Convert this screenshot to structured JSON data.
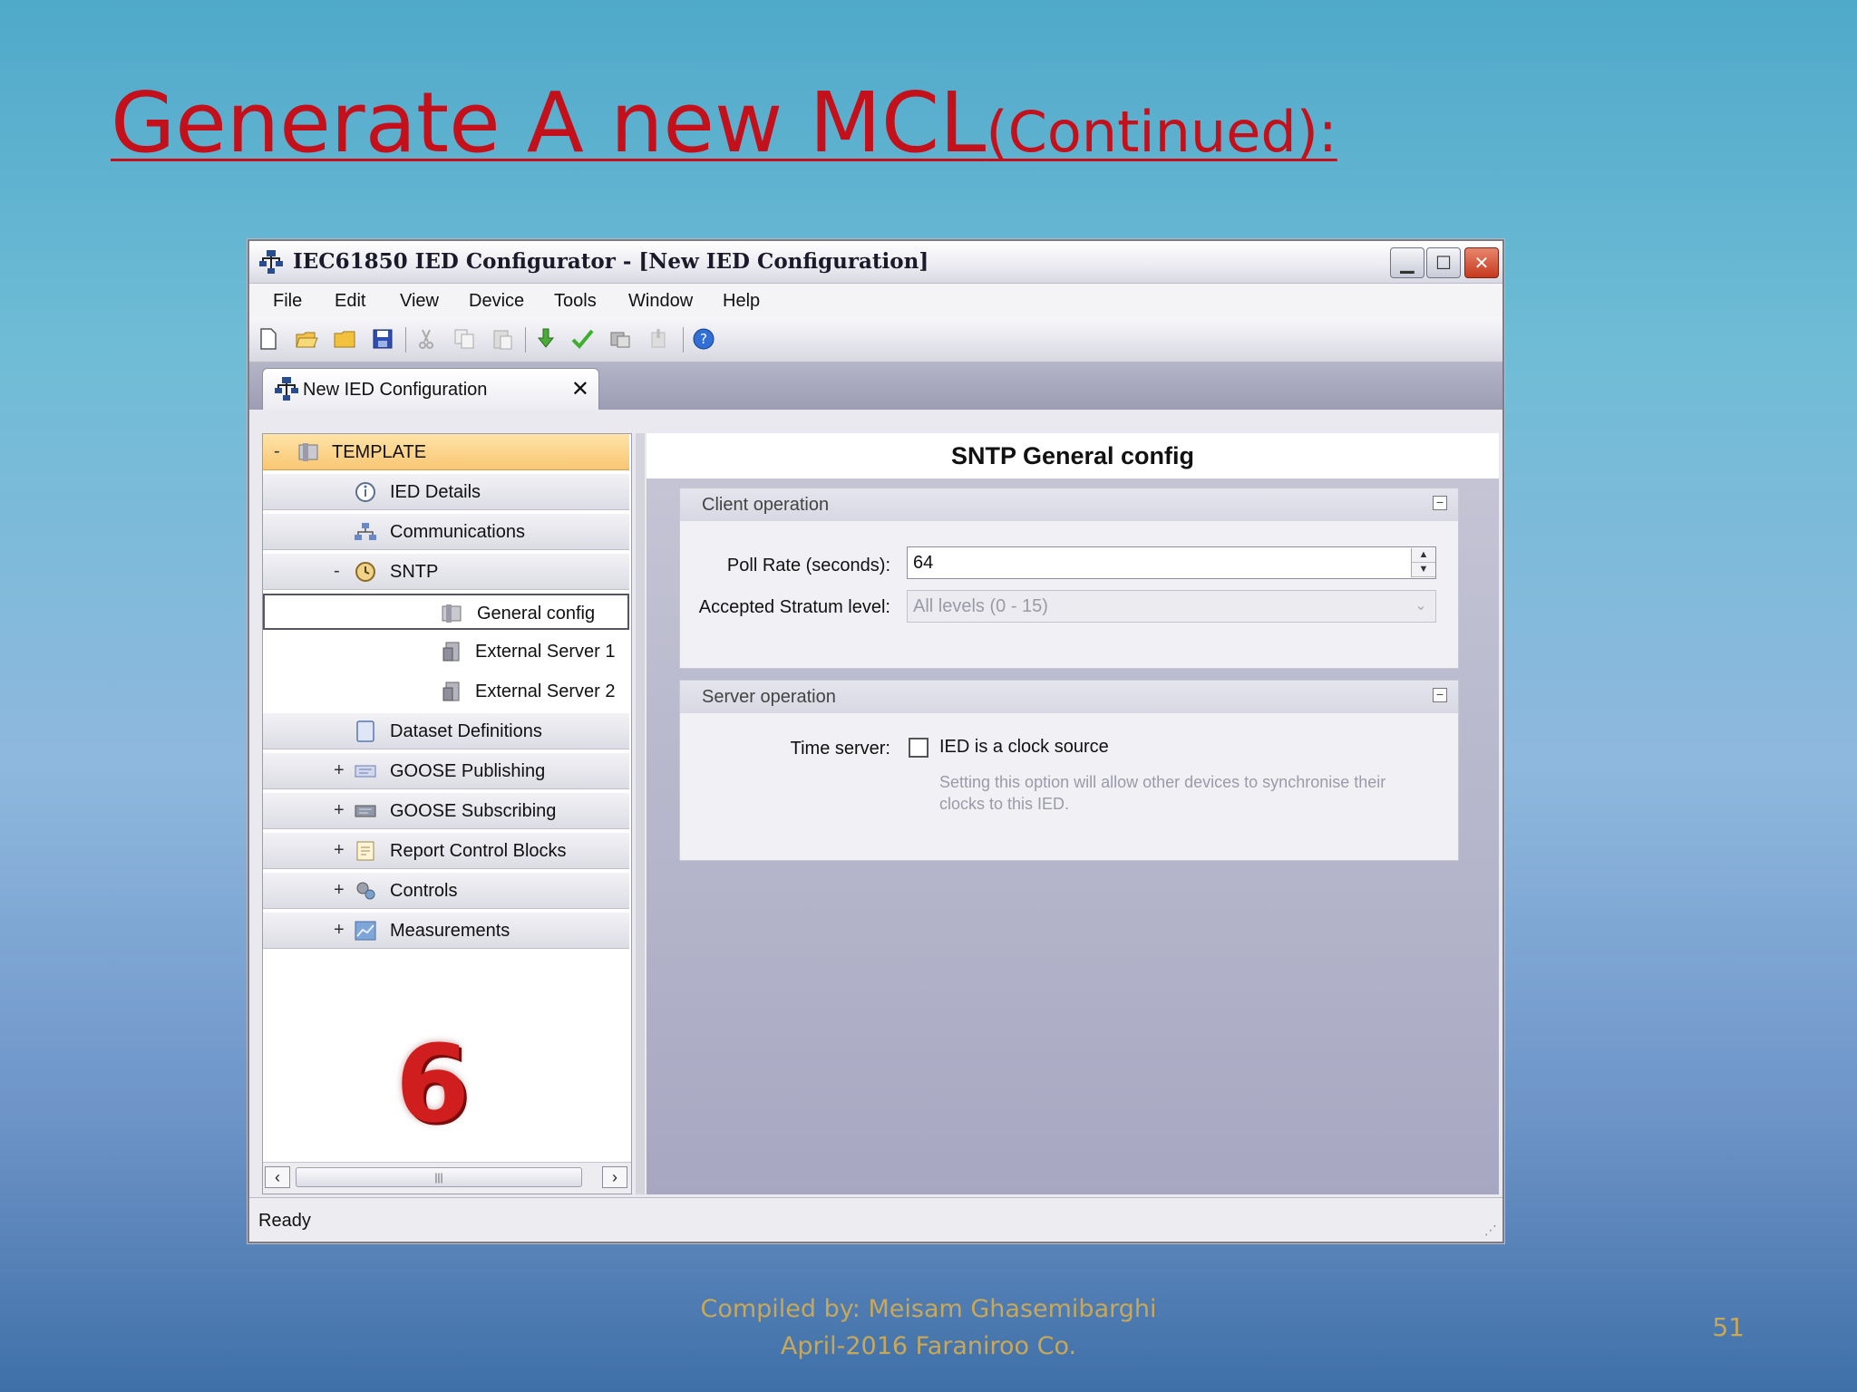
{
  "slide": {
    "title_main": "Generate A new MCL",
    "title_suffix": "(Continued):",
    "footer_line1": "Compiled by: Meisam Ghasemibarghi",
    "footer_line2": "April-2016 Faraniroo Co.",
    "page_number": "51",
    "step_number": "6"
  },
  "window": {
    "title": "IEC61850 IED Configurator - [New IED Configuration]",
    "menu": [
      "File",
      "Edit",
      "View",
      "Device",
      "Tools",
      "Window",
      "Help"
    ],
    "tab_label": "New IED Configuration",
    "status": "Ready"
  },
  "tree": {
    "root": "TEMPLATE",
    "items": [
      {
        "label": "IED Details",
        "expander": ""
      },
      {
        "label": "Communications",
        "expander": ""
      },
      {
        "label": "SNTP",
        "expander": "-"
      },
      {
        "label": "General config",
        "expander": ""
      },
      {
        "label": "External Server 1",
        "expander": ""
      },
      {
        "label": "External Server 2",
        "expander": ""
      },
      {
        "label": "Dataset Definitions",
        "expander": ""
      },
      {
        "label": "GOOSE Publishing",
        "expander": "+"
      },
      {
        "label": "GOOSE Subscribing",
        "expander": "+"
      },
      {
        "label": "Report Control Blocks",
        "expander": "+"
      },
      {
        "label": "Controls",
        "expander": "+"
      },
      {
        "label": "Measurements",
        "expander": "+"
      }
    ]
  },
  "content": {
    "title": "SNTP General config",
    "client_group": "Client operation",
    "poll_rate_label": "Poll Rate (seconds):",
    "poll_rate_value": "64",
    "stratum_label": "Accepted Stratum level:",
    "stratum_value": "All levels (0 - 15)",
    "server_group": "Server operation",
    "time_server_label": "Time server:",
    "clock_source_label": "IED is a clock source",
    "clock_hint": "Setting this option will allow other devices to synchronise their clocks to this IED."
  },
  "colors": {
    "title_red": "#c4101a",
    "template_row": "#f9c773",
    "footer_gold": "#c7a85a"
  }
}
